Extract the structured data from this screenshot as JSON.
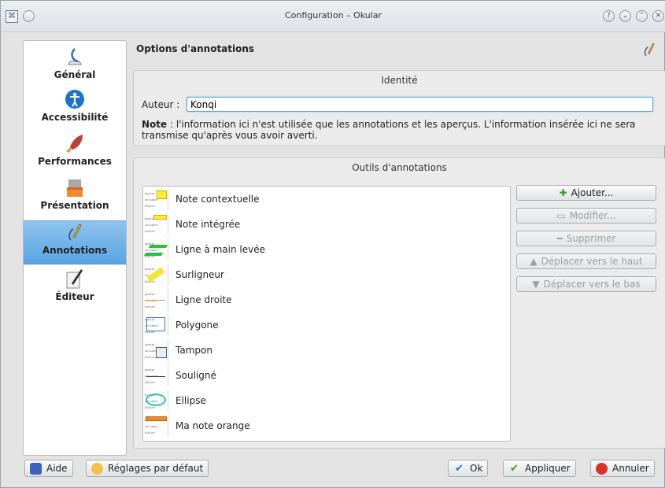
{
  "window": {
    "title": "Configuration – Okular",
    "app_icon": "okular-app-icon"
  },
  "titlebar_buttons": [
    {
      "name": "help",
      "glyph": "?"
    },
    {
      "name": "minimize",
      "glyph": "⌄"
    },
    {
      "name": "maximize",
      "glyph": "⌃"
    },
    {
      "name": "close",
      "glyph": "✕"
    }
  ],
  "sidebar": {
    "items": [
      {
        "label": "Général",
        "icon": "general-icon",
        "active": false
      },
      {
        "label": "Accessibilité",
        "icon": "accessibility-icon",
        "active": false
      },
      {
        "label": "Performances",
        "icon": "performance-icon",
        "active": false
      },
      {
        "label": "Présentation",
        "icon": "presentation-icon",
        "active": false
      },
      {
        "label": "Annotations",
        "icon": "annotations-icon",
        "active": true
      },
      {
        "label": "Éditeur",
        "icon": "editor-icon",
        "active": false
      }
    ]
  },
  "page": {
    "title": "Options d'annotations"
  },
  "identity": {
    "title": "Identité",
    "author_label": "Auteur :",
    "author_value": "Konqi",
    "note_bold": "Note",
    "note_text": " : l'information ici n'est utilisée que les annotations et les aperçus. L'information insérée ici ne sera transmise qu'après vous avoir averti."
  },
  "tools": {
    "title": "Outils d'annotations",
    "items": [
      {
        "label": "Note contextuelle",
        "icon": "popup-note-icon"
      },
      {
        "label": "Note intégrée",
        "icon": "inline-note-icon"
      },
      {
        "label": "Ligne à main levée",
        "icon": "freehand-line-icon"
      },
      {
        "label": "Surligneur",
        "icon": "highlighter-icon"
      },
      {
        "label": "Ligne droite",
        "icon": "straight-line-icon"
      },
      {
        "label": "Polygone",
        "icon": "polygon-icon"
      },
      {
        "label": "Tampon",
        "icon": "stamp-icon"
      },
      {
        "label": "Souligné",
        "icon": "underline-icon"
      },
      {
        "label": "Ellipse",
        "icon": "ellipse-icon"
      },
      {
        "label": "Ma note orange",
        "icon": "orange-note-icon"
      }
    ],
    "thumb_text": [
      "ipsum",
      "sit amet",
      "dolore"
    ],
    "buttons": {
      "add": "Ajouter...",
      "edit": "Modifier...",
      "remove": "Supprimer",
      "move_up": "Déplacer vers le haut",
      "move_down": "Déplacer vers le bas"
    }
  },
  "footer": {
    "help": "Aide",
    "defaults": "Réglages par défaut",
    "ok": "Ok",
    "apply": "Appliquer",
    "cancel": "Annuler"
  },
  "colors": {
    "accent": "#5aa5e2",
    "add_green": "#3c9a2a",
    "cancel_red": "#d9312b"
  }
}
